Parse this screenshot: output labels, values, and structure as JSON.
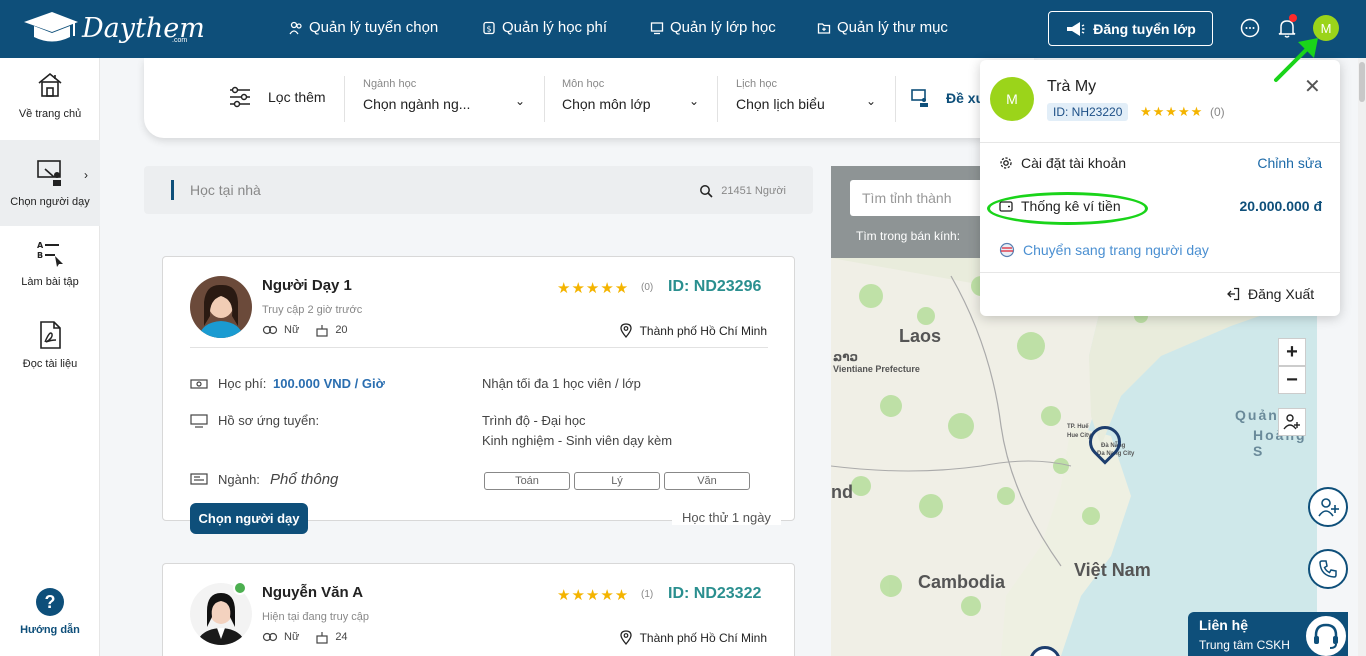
{
  "brand": {
    "name": "Daythem",
    "suffix": ".com"
  },
  "nav": {
    "items": [
      {
        "label": "Quản lý tuyển chọn",
        "icon": "users-icon"
      },
      {
        "label": "Quản lý học phí",
        "icon": "tuition-icon"
      },
      {
        "label": "Quản lý lớp học",
        "icon": "class-icon"
      },
      {
        "label": "Quản lý thư mục",
        "icon": "folder-icon"
      }
    ],
    "post_button": "Đăng tuyển lớp",
    "avatar_initial": "M"
  },
  "sidebar": {
    "items": [
      {
        "label": "Về trang chủ",
        "icon": "home-icon"
      },
      {
        "label": "Chọn người dạy",
        "icon": "teacher-icon"
      },
      {
        "label": "Làm bài tập",
        "icon": "exercise-icon"
      },
      {
        "label": "Đọc tài liệu",
        "icon": "pdf-icon"
      }
    ],
    "help": "Hướng dẫn"
  },
  "filter": {
    "more": "Lọc thêm",
    "major": {
      "label": "Ngành học",
      "value": "Chọn ngành ng..."
    },
    "subject": {
      "label": "Môn học",
      "value": "Chọn môn lớp"
    },
    "schedule": {
      "label": "Lịch học",
      "value": "Chọn lịch biểu"
    },
    "propose": "Đề xu"
  },
  "search": {
    "placeholder": "Học tại nhà",
    "count": "21451 Người"
  },
  "tutors": [
    {
      "name": "Người Dạy 1",
      "access": "Truy cập 2 giờ trước",
      "gender": "Nữ",
      "age": "20",
      "rating": 5,
      "reviews": "(0)",
      "id": "ID: ND23296",
      "location": "Thành phố Hồ Chí Minh",
      "fee_label": "Học phí:",
      "fee": "100.000 VND / Giờ",
      "max_students": "Nhận tối đa 1 học viên / lớp",
      "profile_label": "Hồ sơ ứng tuyển:",
      "level": "Trình độ - Đại học",
      "experience": "Kinh nghiệm - Sinh viên dạy kèm",
      "major_label": "Ngành:",
      "major": "Phổ thông",
      "subjects": [
        "Toán",
        "Lý",
        "Văn"
      ],
      "choose_button": "Chọn người dạy",
      "trial": "Học thử 1 ngày"
    },
    {
      "name": "Nguyễn Văn A",
      "access": "Hiện tại đang truy cập",
      "gender": "Nữ",
      "age": "24",
      "rating": 5,
      "reviews": "(1)",
      "id": "ID: ND23322",
      "location": "Thành phố Hồ Chí Minh"
    }
  ],
  "map": {
    "search_placeholder": "Tìm tỉnh thành",
    "radius_label": "Tìm trong bán kính:",
    "labels": {
      "laos": "Laos",
      "laos_local": "ລາວ",
      "vientiane": "Vientiane Prefecture",
      "cambodia": "Cambodia",
      "vietnam": "Việt Nam",
      "nd": "nd",
      "quang": "Quảng",
      "hoang": "Hoàng S",
      "hue": "TP. Huế",
      "hue2": "Hue City",
      "danang": "Đà Nẵng",
      "danang2": "Da Nang City"
    },
    "zoom_in": "+",
    "zoom_out": "−"
  },
  "account": {
    "initial": "M",
    "name": "Trà My",
    "id": "ID: NH23220",
    "reviews": "(0)",
    "settings": "Cài đặt tài khoản",
    "edit": "Chỉnh sửa",
    "wallet": "Thống kê ví tiền",
    "balance": "20.000.000 đ",
    "switch": "Chuyển sang trang người dạy",
    "logout": "Đăng Xuất",
    "close": "✕"
  },
  "contact": {
    "title": "Liên hệ",
    "subtitle": "Trung tâm CSKH"
  },
  "colors": {
    "primary": "#0e4f7a",
    "avatar": "#9bd41a",
    "star": "#f4b400",
    "id": "#2a8f8f",
    "highlight": "#1ad41a"
  }
}
